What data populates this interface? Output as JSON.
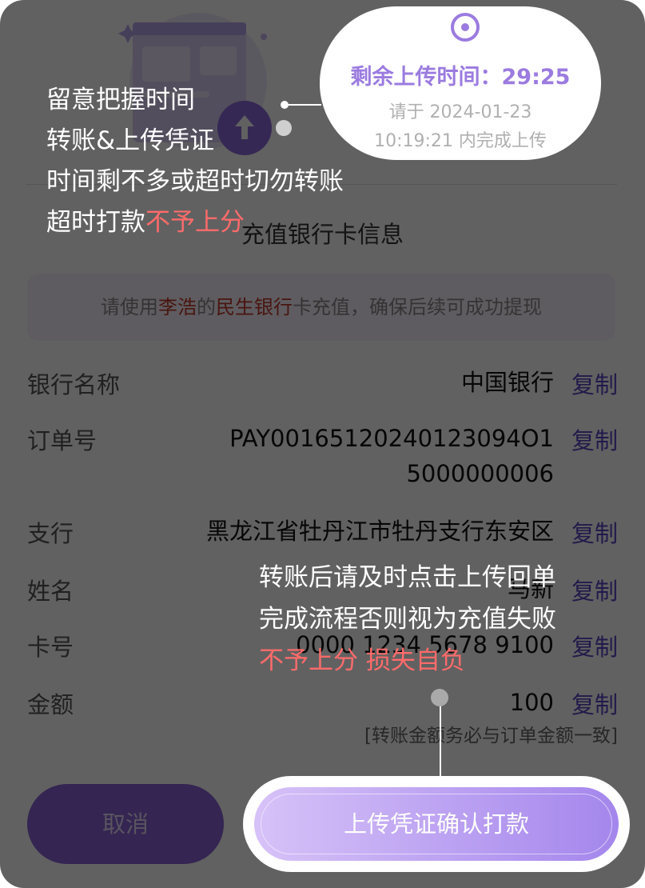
{
  "dialog": {
    "section_title": "充值银行卡信息",
    "notice": {
      "prefix": "请使用",
      "name": "李浩",
      "mid": "的",
      "bank": "民生银行",
      "suffix": "卡充值，确保后续可成功提现"
    },
    "rows": [
      {
        "label": "银行名称",
        "value": "中国银行",
        "copy": "复制"
      },
      {
        "label": "订单号",
        "value_line1": "PAY00165120240123094O1",
        "value_line2": "5000000006",
        "copy": "复制"
      },
      {
        "label": "支行",
        "value": "黑龙江省牡丹江市牡丹支行东安区",
        "copy": "复制"
      },
      {
        "label": "姓名",
        "value": "马新",
        "copy": "复制"
      },
      {
        "label": "卡号",
        "value": "0000 1234 5678 9100",
        "copy": "复制"
      },
      {
        "label": "金额",
        "value": "100",
        "copy": "复制"
      }
    ],
    "amount_warning": "[转账金额务必与订单金额一致]",
    "cancel_label": "取消",
    "confirm_label": "上传凭证确认打款"
  },
  "timer": {
    "label": "剩余上传时间：29:25",
    "deadline_line1": "请于 2024-01-23",
    "deadline_line2": "10:19:21 内完成上传"
  },
  "tip_top": {
    "line1": "留意把握时间",
    "line2": "转账&上传凭证",
    "line3": "时间剩不多或超时切勿转账",
    "line4_prefix": "超时打款",
    "line4_emphasis": "不予上分"
  },
  "tip_bottom": {
    "line1": "转账后请及时点击上传回单",
    "line2": "完成流程否则视为充值失败",
    "line3_emphasis": "不予上分 损失自负"
  },
  "colors": {
    "accent": "#9b7be0",
    "emphasis": "#ff6b6b",
    "link": "#5b45c5"
  }
}
